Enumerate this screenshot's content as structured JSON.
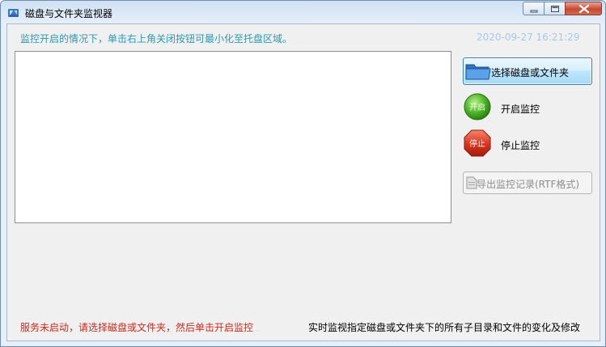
{
  "window": {
    "title": "磁盘与文件夹监视器"
  },
  "header": {
    "hint": "监控开启的情况下，单击右上角关闭按钮可最小化至托盘区域。",
    "datetime": "2020-09-27 16:21:29"
  },
  "buttons": {
    "select_label": "选择磁盘或文件夹",
    "start_label": "开启监控",
    "start_icon_text": "开启",
    "stop_label": "停止监控",
    "stop_icon_text": "停止",
    "export_label": "导出监控记录(RTF格式)"
  },
  "status": {
    "service_message": "服务未启动，请选择磁盘或文件夹，然后单击开启监控",
    "description": "实时监视指定磁盘或文件夹下的所有子目录和文件的变化及修改"
  },
  "colors": {
    "hint": "#2a9ab0",
    "datetime": "#a8c8e8",
    "status_error": "#c82a1c",
    "start_green": "#3fae24",
    "stop_red": "#d8321c"
  },
  "icons": {
    "app": "app-icon",
    "folder": "folder-icon",
    "start": "green-circle-start-icon",
    "stop": "red-octagon-stop-icon",
    "export": "document-icon"
  }
}
